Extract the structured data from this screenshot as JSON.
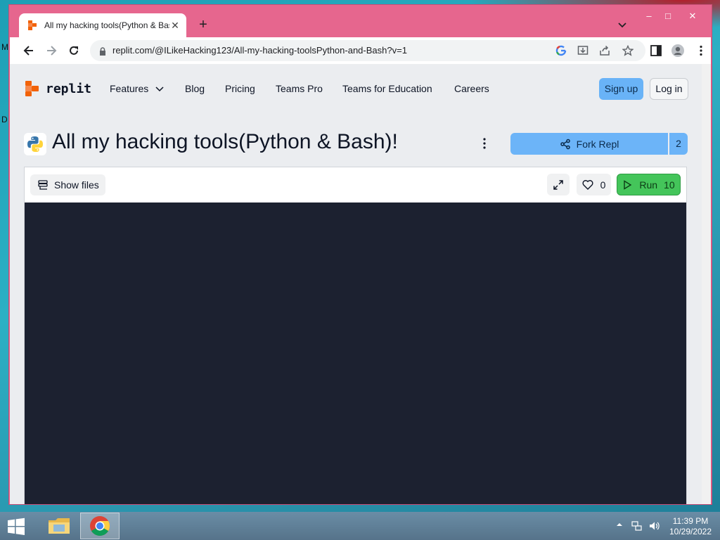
{
  "desktop": {
    "letters": [
      "M",
      "D"
    ]
  },
  "browser": {
    "tab_title": "All my hacking tools(Python & Bash)!",
    "tab_close": "✕",
    "new_tab": "+",
    "url": "replit.com/@ILikeHacking123/All-my-hacking-toolsPython-and-Bash?v=1",
    "window_controls": {
      "minimize": "–",
      "maximize": "□",
      "close": "✕"
    },
    "accent_color": "#e6668e"
  },
  "header": {
    "logo_text": "replit",
    "nav": [
      "Features",
      "Blog",
      "Pricing",
      "Teams Pro",
      "Teams for Education",
      "Careers"
    ],
    "signup": "Sign up",
    "login": "Log in"
  },
  "repl": {
    "title": "All my hacking tools(Python & Bash)!",
    "fork_label": "Fork Repl",
    "fork_count": "2",
    "show_files": "Show files",
    "likes": "0",
    "run_label": "Run",
    "run_count": "10",
    "language_icon": "python-icon"
  },
  "taskbar": {
    "time": "11:39 PM",
    "date": "10/29/2022"
  }
}
